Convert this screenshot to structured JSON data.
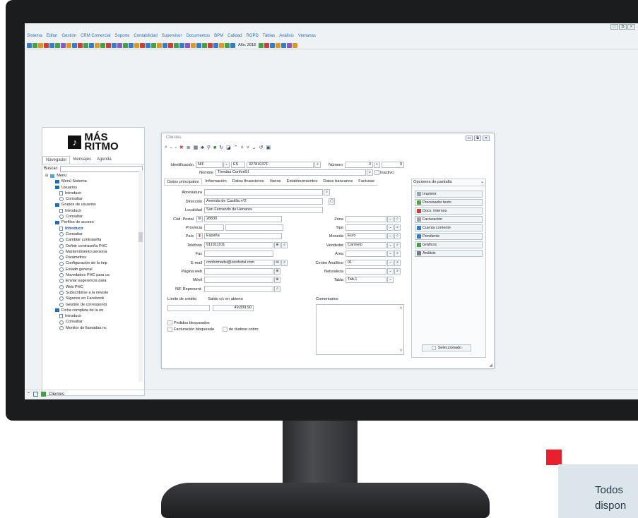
{
  "window_controls": [
    "▭",
    "⧉",
    "✕"
  ],
  "menu": [
    "Sistema",
    "Editar",
    "Gestión",
    "CRM Comercial",
    "Soporte",
    "Contabilidad",
    "Supervisor",
    "Documentos",
    "BPM",
    "Calidad",
    "RGPD",
    "Tablas",
    "Análisis",
    "Ventanas"
  ],
  "toolbar": {
    "year_label": "Año: 2018"
  },
  "logo": {
    "line1": "MÁS",
    "line2": "RITMO",
    "glyph": "♪"
  },
  "navigator": {
    "tabs": [
      "Navegador",
      "Mensajes",
      "Agenda"
    ],
    "search_label": "Buscar:",
    "tree_root": "Menú",
    "items": [
      {
        "label": "Menú Sistema",
        "icon": "folder"
      },
      {
        "label": "Usuarios",
        "icon": "folder"
      },
      {
        "label": "Introducir",
        "icon": "doc"
      },
      {
        "label": "Consultar",
        "icon": "circle"
      },
      {
        "label": "Grupos de usuarios",
        "icon": "folder"
      },
      {
        "label": "Introducir",
        "icon": "doc"
      },
      {
        "label": "Consultar",
        "icon": "circle"
      },
      {
        "label": "Perfiles de acceso",
        "icon": "folder"
      },
      {
        "label": "Introducir",
        "icon": "doc"
      },
      {
        "label": "Consultar",
        "icon": "circle"
      },
      {
        "label": "Cambiar contraseña",
        "icon": "circle"
      },
      {
        "label": "Definir contraseña PHC",
        "icon": "circle"
      },
      {
        "label": "Mantenimiento persona",
        "icon": "circle"
      },
      {
        "label": "Parámetros",
        "icon": "circle"
      },
      {
        "label": "Configuración de la imp",
        "icon": "circle"
      },
      {
        "label": "Estado general",
        "icon": "circle"
      },
      {
        "label": "Novedades PHC para us",
        "icon": "circle"
      },
      {
        "label": "Enviar sugerencia para",
        "icon": "circle"
      },
      {
        "label": "Web PHC",
        "icon": "circle"
      },
      {
        "label": "Subscribirse a la newsle",
        "icon": "circle"
      },
      {
        "label": "Síganos en Facebook",
        "icon": "circle"
      },
      {
        "label": "Gestión de correspondi",
        "icon": "circle"
      },
      {
        "label": "Ficha completa de la en",
        "icon": "folder"
      },
      {
        "label": "Introducir",
        "icon": "doc"
      },
      {
        "label": "Consultar",
        "icon": "circle"
      },
      {
        "label": "Monitor de llamadas nc",
        "icon": "circle"
      }
    ],
    "selected_index": 8
  },
  "taskbar": {
    "label": "Clientes"
  },
  "clientes": {
    "title": "Clientes",
    "ident_label": "Identificación",
    "ident_type": "NIF",
    "ident_country": "ES",
    "ident_value": "32781037F",
    "numero_label": "Número",
    "numero_value": "3",
    "numero_extra": "0",
    "nombre_label": "Nombre",
    "nombre_value": "Tiendas ConfortSI",
    "inactivo_label": "Inactivo",
    "tabs": [
      "Datos principales",
      "Información",
      "Datos financieros",
      "Varios",
      "Establecimientos",
      "Datos bancarios",
      "Facturae"
    ],
    "fields_left": {
      "abreviatura": {
        "label": "Abreviatura",
        "value": ""
      },
      "direccion": {
        "label": "Dirección",
        "value": "Avenida de Castilla nº2"
      },
      "localidad": {
        "label": "Localidad",
        "value": "San Fernando de Henares"
      },
      "cp": {
        "label": "Cód. Postal",
        "value": "28830"
      },
      "provincia": {
        "label": "Provincia",
        "value": ""
      },
      "pais": {
        "label": "País",
        "value": "España"
      },
      "telefono": {
        "label": "Teléfono",
        "value": "911911911"
      },
      "fax": {
        "label": "Fax",
        "value": ""
      },
      "email": {
        "label": "E-mail",
        "value": "conformadsi@confortsi.com"
      },
      "web": {
        "label": "Página web",
        "value": ""
      },
      "movil": {
        "label": "Móvil",
        "value": ""
      },
      "nif_rep": {
        "label": "NIF Represent.",
        "value": ""
      }
    },
    "fields_right": {
      "zona": {
        "label": "Zona",
        "value": ""
      },
      "tipo": {
        "label": "Tipo",
        "value": ""
      },
      "moneda": {
        "label": "Moneda",
        "value": "Euro"
      },
      "vendedor": {
        "label": "Vendedor",
        "value": "Carmelo"
      },
      "area": {
        "label": "Área",
        "value": ""
      },
      "centro": {
        "label": "Centro Analítico",
        "value": "01"
      },
      "naturaleza": {
        "label": "Naturaleza",
        "value": ""
      },
      "tabla": {
        "label": "Tabla",
        "value": "Tab.1"
      }
    },
    "limite_label": "Límite de crédito",
    "saldo_label": "Saldo c/c en abierto",
    "saldo_value": "49,839.90",
    "comentarios_label": "Comentarios",
    "pedidos_bloqueados": "Pedidos bloqueados",
    "facturacion_bloqueada": "Facturación bloqueada",
    "dudoso_cobro": "de dudoso cobro",
    "options_header": "Opciones de pantalla",
    "options": [
      "Imprimir",
      "Procesador texto",
      "Docs. internos",
      "Facturación",
      "Cuenta corriente",
      "Pendiente",
      "Gráficos",
      "Análisis"
    ],
    "seleccionado": "Seleccionado"
  },
  "promo": {
    "line1": "Todos",
    "line2": "dispon"
  }
}
